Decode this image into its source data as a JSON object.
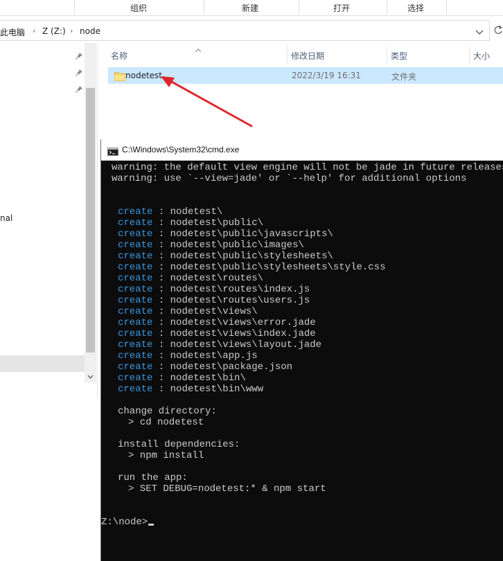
{
  "ribbon": {
    "groups": [
      "组织",
      "新建",
      "打开",
      "选择"
    ]
  },
  "address": {
    "crumbs": [
      "此电脑",
      "Z (Z:)",
      "node"
    ],
    "separator": "›"
  },
  "nav": {
    "partial_item": "nal"
  },
  "columns": {
    "name": "名称",
    "modified": "修改日期",
    "type": "类型",
    "size": "大小"
  },
  "files": [
    {
      "name": "nodetest",
      "modified": "2022/3/19 16:31",
      "type": "文件夹"
    }
  ],
  "cmd": {
    "title": "C:\\Windows\\System32\\cmd.exe",
    "warnings": [
      "warning: the default view engine will not be jade in future releases",
      "warning: use `--view=jade' or `--help' for additional options"
    ],
    "create_keyword": "create",
    "create_sep": " : ",
    "created": [
      "nodetest\\",
      "nodetest\\public\\",
      "nodetest\\public\\javascripts\\",
      "nodetest\\public\\images\\",
      "nodetest\\public\\stylesheets\\",
      "nodetest\\public\\stylesheets\\style.css",
      "nodetest\\routes\\",
      "nodetest\\routes\\index.js",
      "nodetest\\routes\\users.js",
      "nodetest\\views\\",
      "nodetest\\views\\error.jade",
      "nodetest\\views\\index.jade",
      "nodetest\\views\\layout.jade",
      "nodetest\\app.js",
      "nodetest\\package.json",
      "nodetest\\bin\\",
      "nodetest\\bin\\www"
    ],
    "instructions": [
      {
        "heading": "change directory:",
        "command": "> cd nodetest"
      },
      {
        "heading": "install dependencies:",
        "command": "> npm install"
      },
      {
        "heading": "run the app:",
        "command": "> SET DEBUG=nodetest:* & npm start"
      }
    ],
    "prompt": "Z:\\node>"
  },
  "colors": {
    "selection": "#cce8ff",
    "cmd_bg": "#0c0c0c",
    "cmd_text": "#cccccc",
    "cmd_keyword": "#3a96dd",
    "annotation": "#e0262c"
  },
  "icons": [
    "pin-icon",
    "folder-icon",
    "sort-up-icon",
    "chevron-down-icon",
    "refresh-icon",
    "cmd-icon",
    "annotation-arrow-icon"
  ]
}
